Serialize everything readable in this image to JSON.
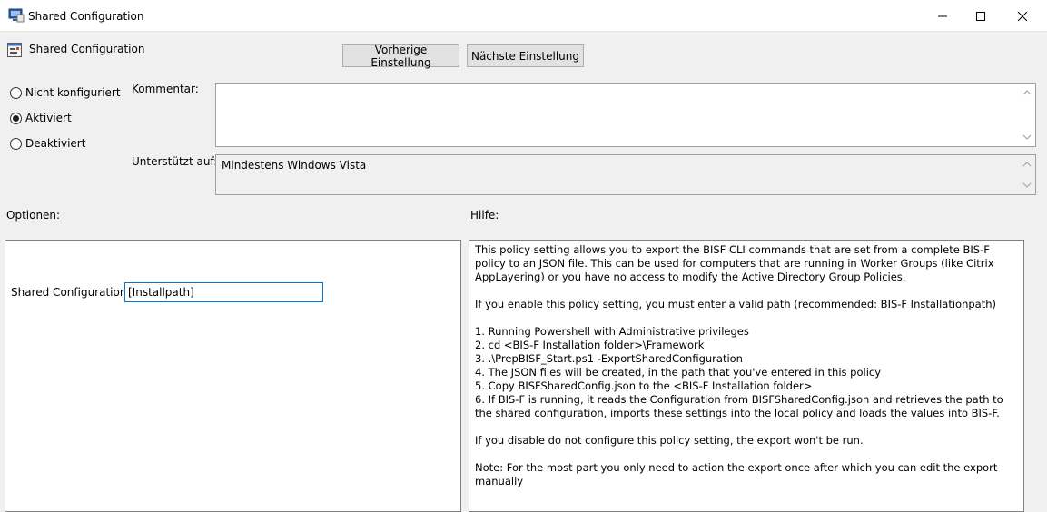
{
  "window": {
    "title": "Shared Configuration",
    "controls": {
      "minimize": "minimize-icon",
      "maximize": "maximize-icon",
      "close": "close-icon"
    }
  },
  "header": {
    "title": "Shared Configuration",
    "icon": "policy-icon"
  },
  "nav": {
    "prev_label": "Vorherige Einstellung",
    "next_label": "Nächste Einstellung"
  },
  "state": {
    "options": [
      {
        "label": "Nicht konfiguriert",
        "checked": false
      },
      {
        "label": "Aktiviert",
        "checked": true
      },
      {
        "label": "Deaktiviert",
        "checked": false
      }
    ]
  },
  "comment": {
    "label": "Kommentar:",
    "value": ""
  },
  "supported": {
    "label": "Unterstützt auf:",
    "value": "Mindestens Windows Vista"
  },
  "options_section": {
    "label": "Optionen:",
    "field_label": "Shared Configuration",
    "field_value": "[Installpath]"
  },
  "help_section": {
    "label": "Hilfe:",
    "paragraphs": [
      "This policy setting allows you to export the BISF CLI commands that are set from a complete BIS-F policy to an JSON file. This can be used for computers that are running in Worker Groups (like Citrix AppLayering) or you have no access to modify the Active Directory Group Policies.",
      "If you enable this policy setting, you must enter a valid path (recommended: BIS-F Installationpath)",
      "1. Running Powershell with Administrative privileges\n2. cd <BIS-F Installation folder>\\Framework\n3. .\\PrepBISF_Start.ps1 -ExportSharedConfiguration\n4. The JSON files will be created, in the path that you've entered in this policy\n5. Copy BISFSharedConfig.json to the <BIS-F Installation folder>\n6. If BIS-F is running, it reads the Configuration from BISFSharedConfig.json and retrieves the path to the shared configuration, imports these settings into the local policy and loads the values into BIS-F.",
      "If you disable do not configure this policy setting, the export won't be run.",
      "Note: For the most part you only need to action the export once after which you can edit the export manually"
    ]
  },
  "colors": {
    "accent": "#0078d7",
    "background": "#f0f0f0"
  }
}
